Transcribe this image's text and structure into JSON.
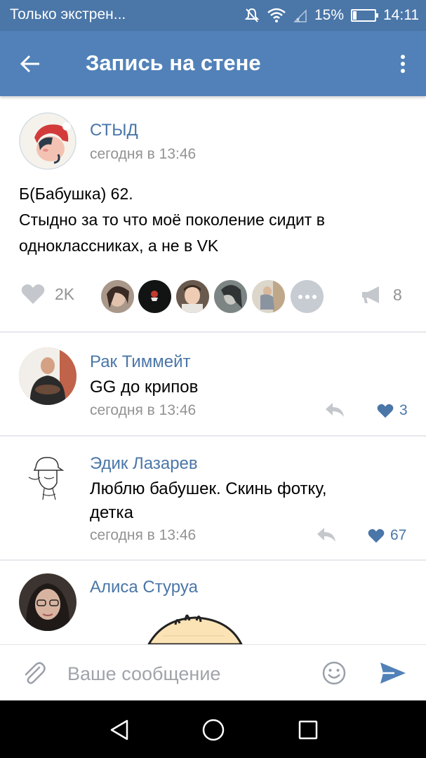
{
  "status_bar": {
    "carrier": "Только экстрен...",
    "battery": "15%",
    "time": "14:11",
    "battery_level": 0.15
  },
  "app_bar": {
    "title": "Запись на стене",
    "back_icon": "arrow-left-icon",
    "menu_icon": "more-vertical-icon"
  },
  "post": {
    "author": "СТЫД",
    "time": "сегодня в 13:46",
    "text_lines": [
      "Б(Бабушка) 62.",
      "Стыдно за то что моё поколение сидит в",
      "одноклассниках, а не в VK"
    ],
    "likes_count": "2K",
    "shares_count": "8",
    "likers": [
      "liker-1",
      "liker-2",
      "liker-3",
      "liker-4",
      "liker-5"
    ]
  },
  "comments": [
    {
      "author": "Рак Тиммейт",
      "text_lines": [
        "GG до крипов"
      ],
      "time": "сегодня в 13:46",
      "likes": "3"
    },
    {
      "author": "Эдик Лазарев",
      "text_lines": [
        "Люблю бабушек. Скинь фотку,",
        "детка"
      ],
      "time": "сегодня в 13:46",
      "likes": "67"
    },
    {
      "author": "Алиса Стуруа",
      "text_lines": [],
      "time": "",
      "likes": ""
    }
  ],
  "composer": {
    "placeholder": "Ваше сообщение",
    "value": ""
  },
  "colors": {
    "header": "#5181b8",
    "status": "#4a76a8",
    "link": "#4a76a8",
    "muted": "#939393"
  }
}
